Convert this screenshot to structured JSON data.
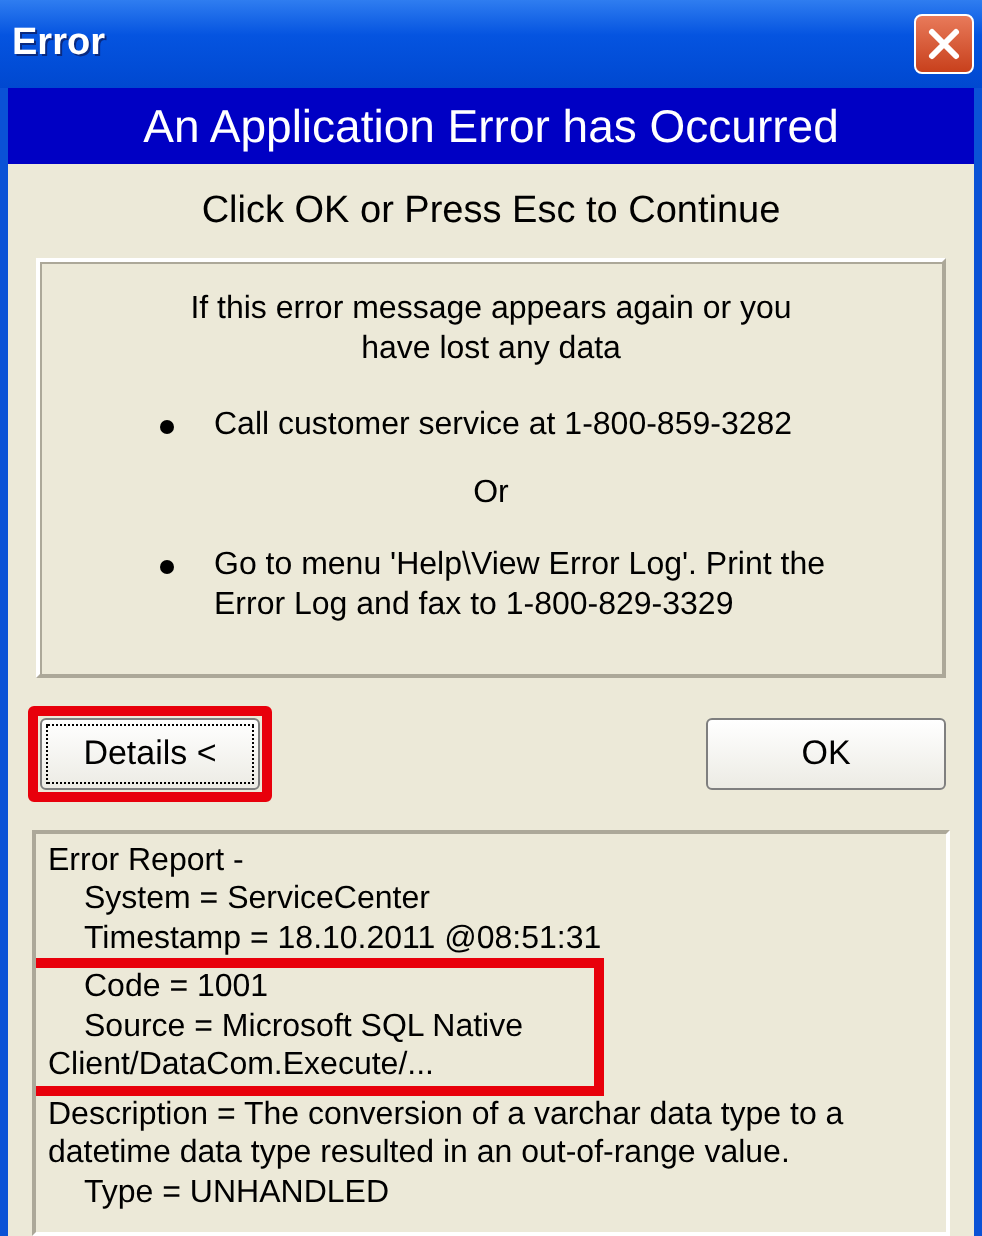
{
  "window": {
    "title": "Error"
  },
  "banner": "An Application Error has Occurred",
  "instruction": "Click OK or Press Esc to Continue",
  "message": {
    "intro": "If this error message appears again or you have lost any data",
    "items": [
      {
        "kind": "bullet",
        "text": "Call customer service at 1-800-859-3282"
      },
      {
        "kind": "separator",
        "text": "Or"
      },
      {
        "kind": "bullet",
        "text": "Go to menu 'Help\\View Error Log'. Print the Error Log and fax to 1-800-829-3329"
      }
    ]
  },
  "buttons": [
    {
      "label": "Details <",
      "focused": true,
      "highlighted": true
    },
    {
      "label": "OK",
      "focused": false,
      "highlighted": false
    }
  ],
  "report": {
    "lines": [
      {
        "text": "Error Report -",
        "indented": false,
        "highlighted": false
      },
      {
        "text": "System = ServiceCenter",
        "indented": true,
        "highlighted": false
      },
      {
        "text": "Timestamp = 18.10.2011 @08:51:31",
        "indented": true,
        "highlighted": false
      },
      {
        "text": "Code = 1001",
        "indented": true,
        "highlighted": true
      },
      {
        "text": "Source = Microsoft SQL Native",
        "indented": true,
        "highlighted": true
      },
      {
        "text": "Client/DataCom.Execute/...",
        "indented": false,
        "highlighted": true
      },
      {
        "text": "Description = The conversion of a varchar data type to a",
        "indented": false,
        "highlighted": false
      },
      {
        "text": "datetime data type resulted in an out-of-range value.",
        "indented": false,
        "highlighted": false
      },
      {
        "text": "Type = UNHANDLED",
        "indented": true,
        "highlighted": false
      }
    ]
  }
}
